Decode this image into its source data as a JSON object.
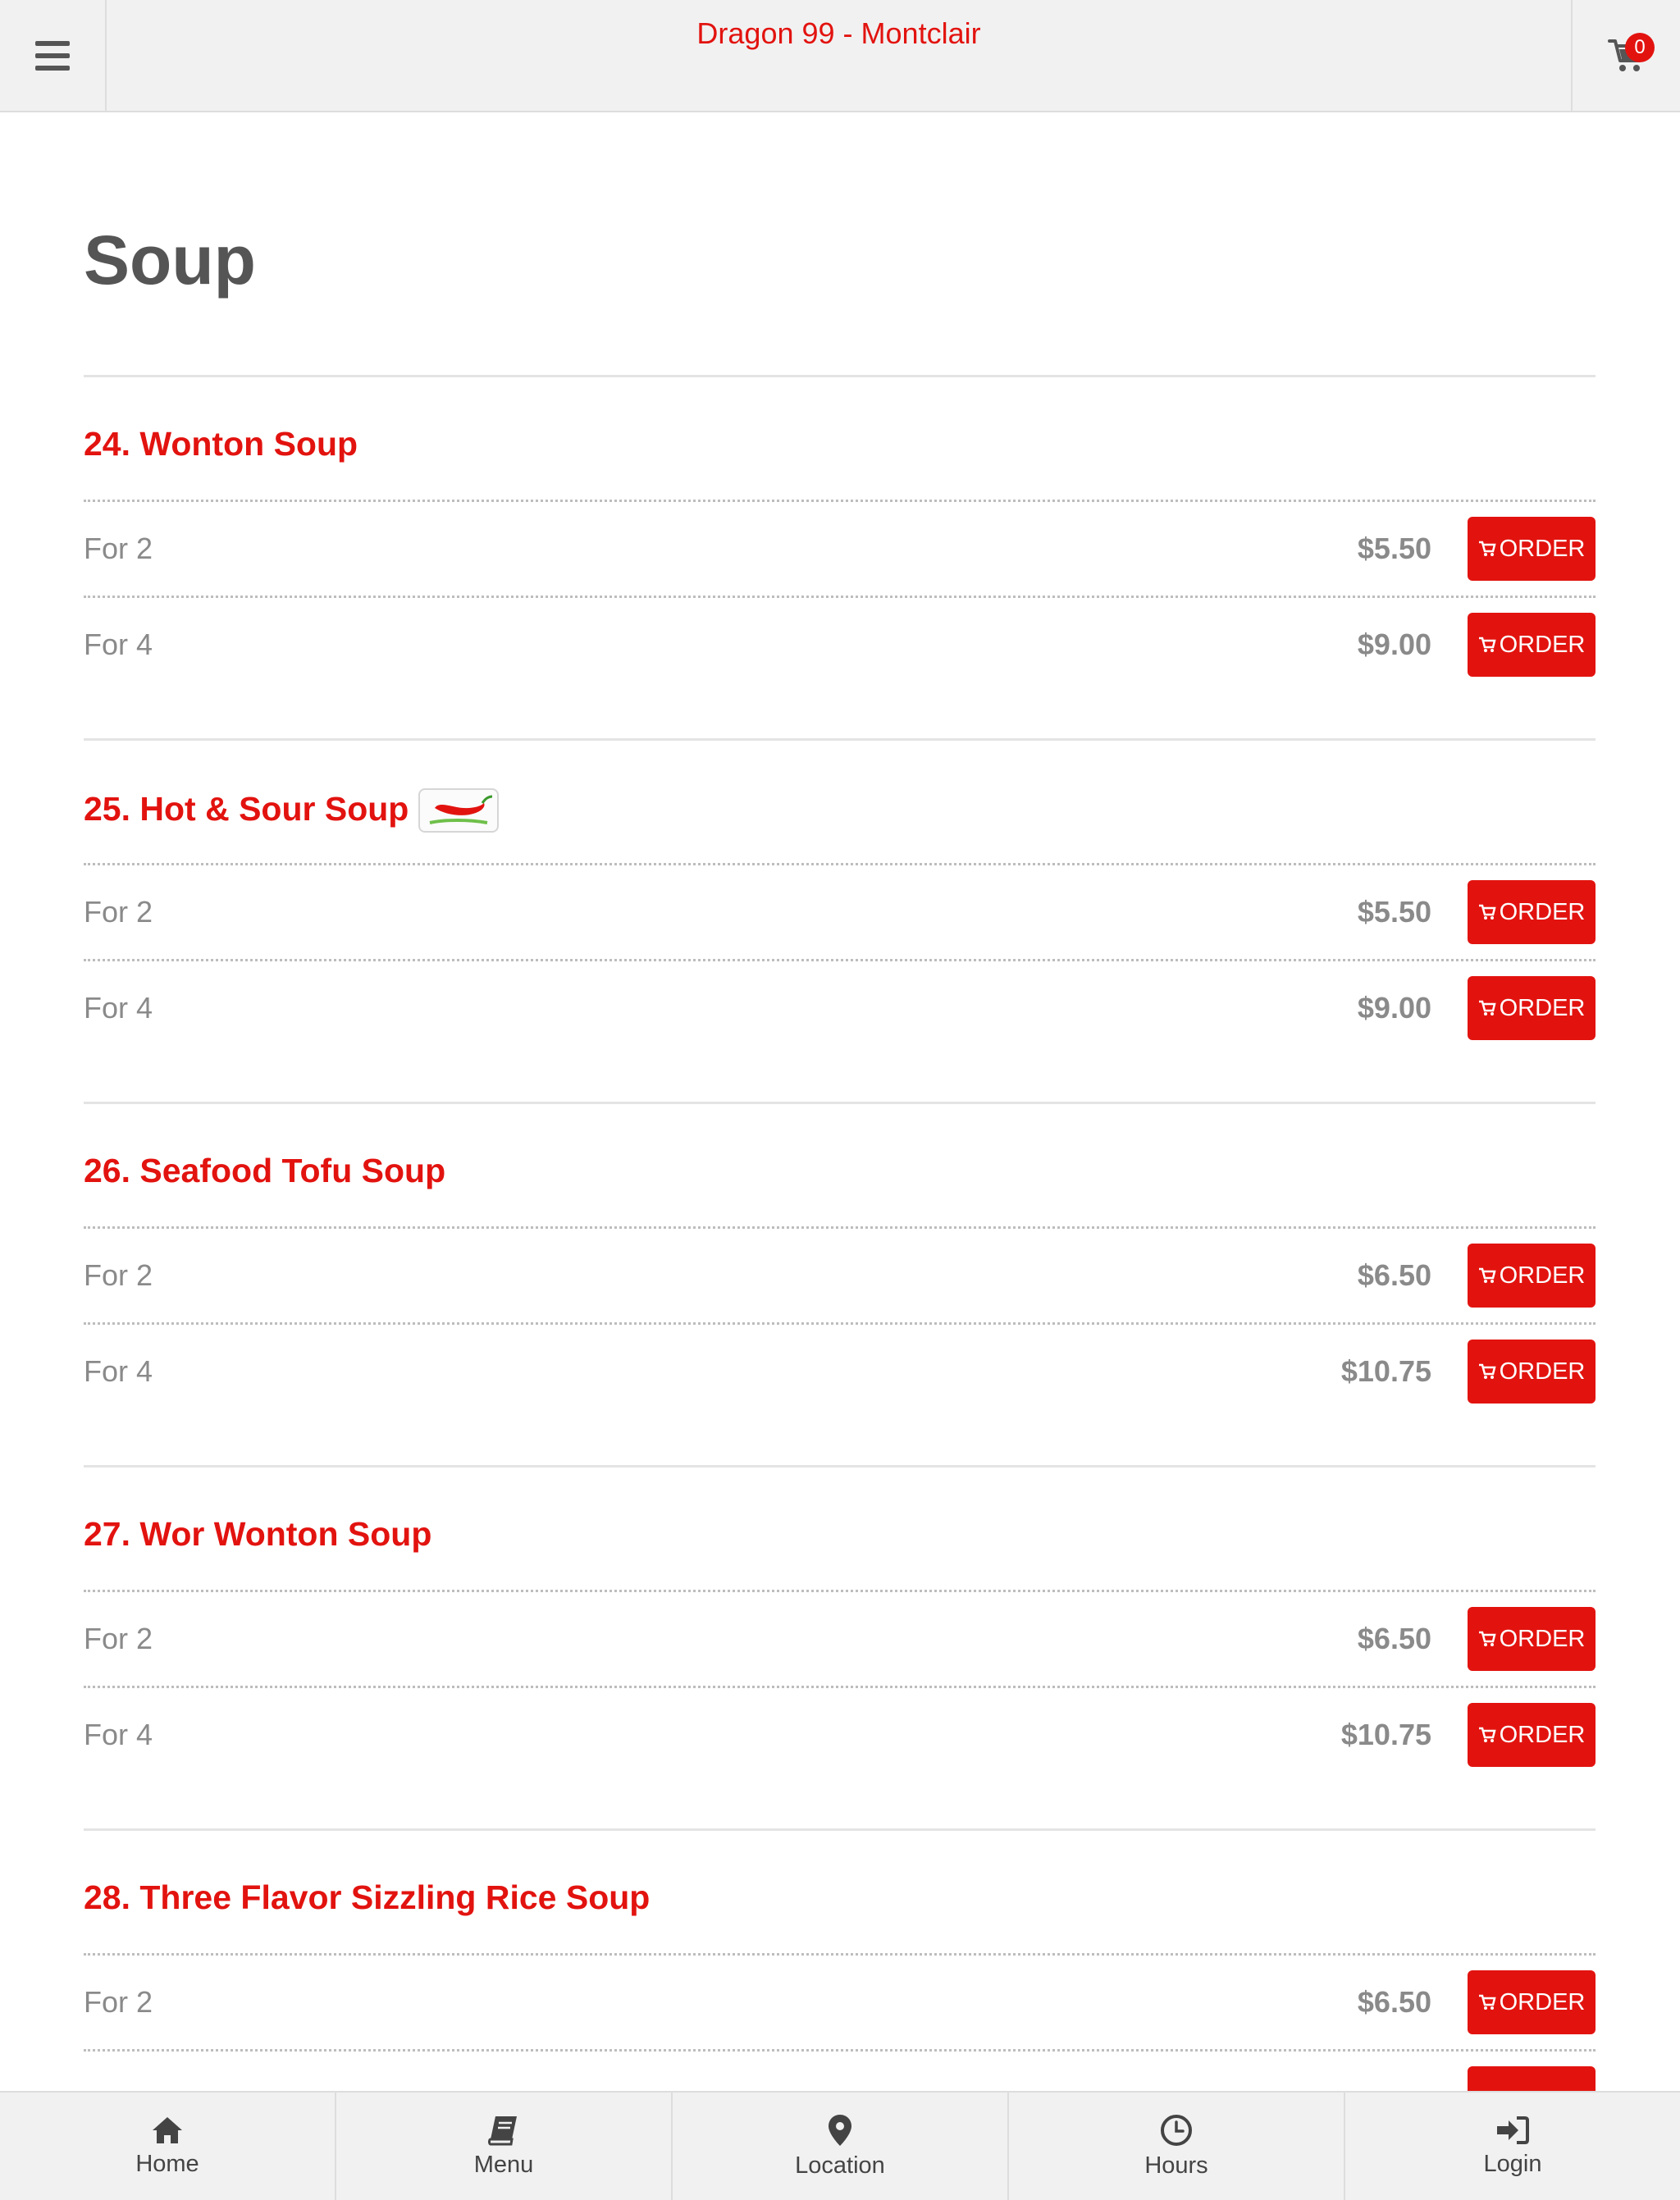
{
  "header": {
    "title": "Dragon 99 - Montclair",
    "cart_count": "0"
  },
  "category": {
    "title": "Soup"
  },
  "items": [
    {
      "name": "24. Wonton Soup",
      "spicy": false,
      "options": [
        {
          "label": "For 2",
          "price": "$5.50",
          "button": "ORDER"
        },
        {
          "label": "For 4",
          "price": "$9.00",
          "button": "ORDER"
        }
      ]
    },
    {
      "name": "25. Hot & Sour Soup",
      "spicy": true,
      "options": [
        {
          "label": "For 2",
          "price": "$5.50",
          "button": "ORDER"
        },
        {
          "label": "For 4",
          "price": "$9.00",
          "button": "ORDER"
        }
      ]
    },
    {
      "name": "26. Seafood Tofu Soup",
      "spicy": false,
      "options": [
        {
          "label": "For 2",
          "price": "$6.50",
          "button": "ORDER"
        },
        {
          "label": "For 4",
          "price": "$10.75",
          "button": "ORDER"
        }
      ]
    },
    {
      "name": "27. Wor Wonton Soup",
      "spicy": false,
      "options": [
        {
          "label": "For 2",
          "price": "$6.50",
          "button": "ORDER"
        },
        {
          "label": "For 4",
          "price": "$10.75",
          "button": "ORDER"
        }
      ]
    },
    {
      "name": "28. Three Flavor Sizzling Rice Soup",
      "spicy": false,
      "options": [
        {
          "label": "For 2",
          "price": "$6.50",
          "button": "ORDER"
        }
      ]
    }
  ],
  "bottom_nav": {
    "items": [
      {
        "label": "Home",
        "icon": "home-icon"
      },
      {
        "label": "Menu",
        "icon": "book-icon"
      },
      {
        "label": "Location",
        "icon": "map-pin-icon"
      },
      {
        "label": "Hours",
        "icon": "clock-icon"
      },
      {
        "label": "Login",
        "icon": "sign-in-icon"
      }
    ]
  },
  "colors": {
    "accent": "#e2130f",
    "header_bg": "#f1f1f1",
    "text_muted": "#8a8a8a",
    "title_text": "#555555"
  }
}
